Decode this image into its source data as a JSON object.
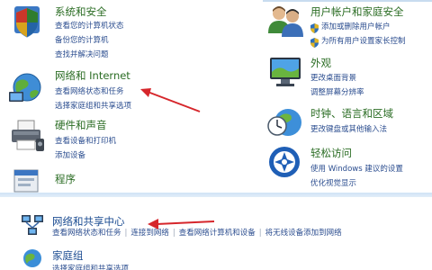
{
  "categories": {
    "system": {
      "title": "系统和安全",
      "links": [
        "查看您的计算机状态",
        "备份您的计算机",
        "查找并解决问题"
      ]
    },
    "network": {
      "title": "网络和 Internet",
      "links": [
        "查看网络状态和任务",
        "选择家庭组和共享选项"
      ]
    },
    "hardware": {
      "title": "硬件和声音",
      "links": [
        "查看设备和打印机",
        "添加设备"
      ]
    },
    "programs": {
      "title": "程序"
    },
    "users": {
      "title": "用户帐户和家庭安全",
      "links": [
        "添加或删除用户帐户",
        "为所有用户设置家长控制"
      ]
    },
    "appearance": {
      "title": "外观",
      "links": [
        "更改桌面背景",
        "调整屏幕分辨率"
      ]
    },
    "clock": {
      "title": "时钟、语言和区域",
      "links": [
        "更改键盘或其他输入法"
      ]
    },
    "ease": {
      "title": "轻松访问",
      "links": [
        "使用 Windows 建议的设置",
        "优化视觉显示"
      ]
    }
  },
  "bottom": {
    "network_center_title": "网络和共享中心",
    "links": [
      "查看网络状态和任务",
      "连接到网络",
      "查看网络计算机和设备",
      "将无线设备添加到网络"
    ],
    "homegroup_title": "家庭组",
    "homegroup_link": "选择家庭组和共享选项"
  },
  "colors": {
    "title_green": "#2a6c23",
    "link_blue": "#2b4d8f",
    "arrow_red": "#d6262b"
  }
}
